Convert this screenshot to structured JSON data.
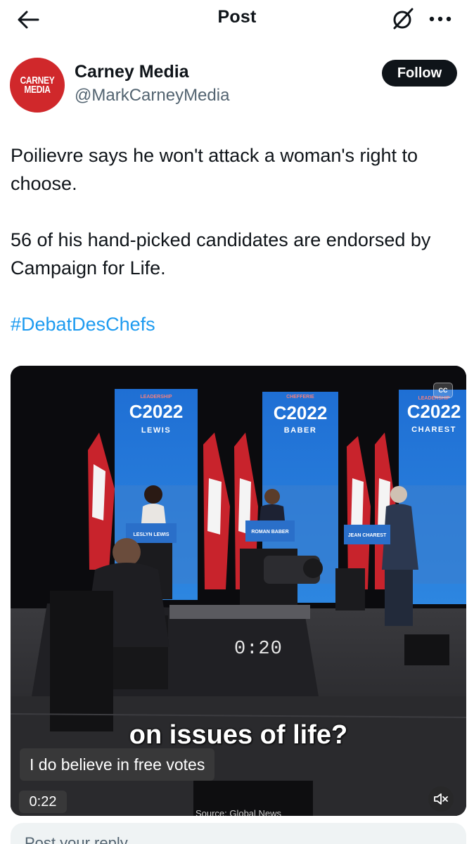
{
  "header": {
    "title": "Post"
  },
  "author": {
    "avatar_line1": "CARNEY",
    "avatar_line2": "MEDIA",
    "name": "Carney Media",
    "handle": "@MarkCarneyMedia",
    "follow_label": "Follow",
    "avatar_color": "#d0282b"
  },
  "post": {
    "paragraph1": "Poilievre says he won't attack a woman's right to choose.",
    "paragraph2": "56 of his hand-picked candidates are endorsed by Campaign for Life.",
    "hashtag": "#DebatDesChefs"
  },
  "video": {
    "cc_label": "CC",
    "on_screen_timer": "0:20",
    "burned_subtitle": "on issues of life?",
    "caption": "I do believe in free votes",
    "time_remaining": "0:22",
    "source": "Source: Global News",
    "banner_top": "LEADERSHIP",
    "banner_top_fr": "CHEFFERIE",
    "banner_year": "2022",
    "banner_names": [
      "LEWIS",
      "BABER",
      "CHAREST"
    ],
    "podium_names": [
      "LESLYN LEWIS",
      "ROMAN BABER",
      "JEAN CHAREST"
    ]
  },
  "reply": {
    "placeholder": "Post your reply"
  },
  "colors": {
    "link": "#1d9bf0",
    "text": "#0f1419",
    "secondary": "#536471",
    "follow_bg": "#0f1419"
  }
}
